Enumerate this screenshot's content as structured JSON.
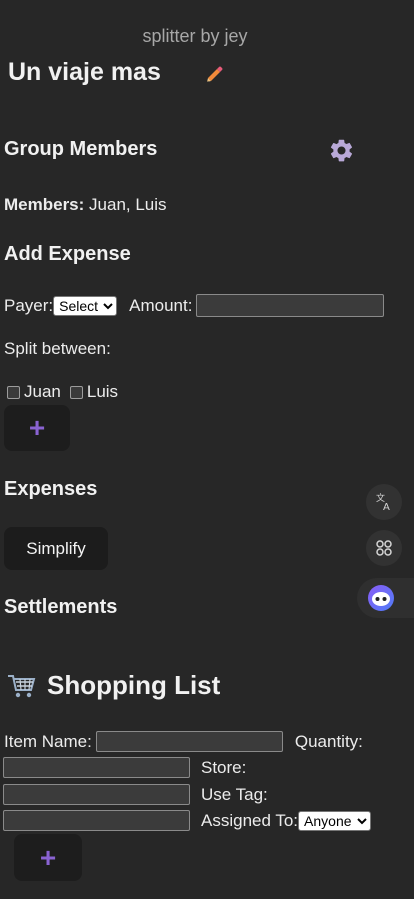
{
  "app": {
    "brand": "splitter by jey"
  },
  "group": {
    "name": "Un viaje mas"
  },
  "members_section": {
    "title": "Group Members",
    "members_label": "Members:",
    "members_value": "Juan, Luis"
  },
  "add_expense": {
    "title": "Add Expense",
    "payer_label": "Payer:",
    "payer_value": "Select",
    "amount_label": "Amount:",
    "amount_value": "",
    "split_label": "Split between:",
    "split_members": [
      "Juan",
      "Luis"
    ],
    "add_button": "+"
  },
  "expenses": {
    "title": "Expenses",
    "simplify_button": "Simplify"
  },
  "settlements": {
    "title": "Settlements"
  },
  "shopping": {
    "title": "Shopping List",
    "item_name_label": "Item Name:",
    "quantity_label": "Quantity:",
    "store_label": "Store:",
    "use_tag_label": "Use Tag:",
    "assigned_label": "Assigned To:",
    "assigned_value": "Anyone",
    "add_button": "+"
  },
  "colors": {
    "background": "#272727",
    "accent_purple": "#8a63d2",
    "pencil_orange": "#e8703a"
  },
  "icons": {
    "edit": "pencil-icon",
    "settings": "gear-icon",
    "translate": "translate-icon",
    "apps": "apps-icon",
    "assistant": "assistant-icon",
    "cart": "cart-icon"
  }
}
